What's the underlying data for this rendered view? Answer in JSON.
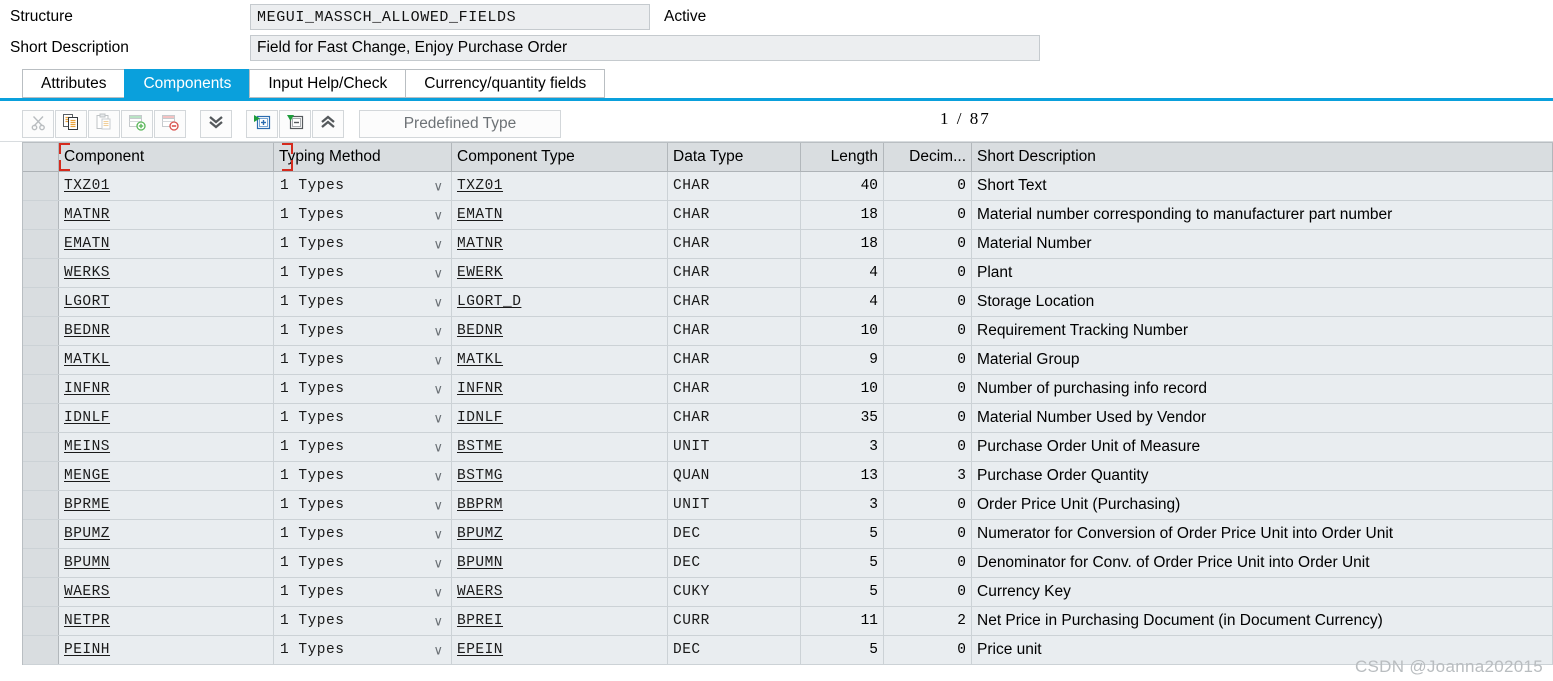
{
  "header": {
    "structure_label": "Structure",
    "structure_name": "MEGUI_MASSCH_ALLOWED_FIELDS",
    "status": "Active",
    "short_desc_label": "Short Description",
    "short_desc_value": "Field for Fast Change, Enjoy Purchase Order"
  },
  "tabs": [
    {
      "label": "Attributes",
      "active": false
    },
    {
      "label": "Components",
      "active": true
    },
    {
      "label": "Input Help/Check",
      "active": false
    },
    {
      "label": "Currency/quantity fields",
      "active": false
    }
  ],
  "toolbar": {
    "buttons": [
      {
        "name": "cut-icon",
        "title": "Cut"
      },
      {
        "name": "copy-icon",
        "title": "Copy"
      },
      {
        "name": "paste-icon",
        "title": "Paste"
      },
      {
        "name": "insert-row-icon",
        "title": "Insert Row"
      },
      {
        "name": "delete-row-icon",
        "title": "Delete Row"
      },
      {
        "name": "chevron-double-down-icon",
        "title": "Expand All"
      },
      {
        "name": "expand-subscreen-icon",
        "title": "Expand"
      },
      {
        "name": "collapse-subscreen-icon",
        "title": "Collapse"
      },
      {
        "name": "chevron-double-up-icon",
        "title": "Collapse All"
      }
    ],
    "predefined_type_label": "Predefined Type",
    "page_current": "1",
    "page_separator": "/",
    "page_total": "87"
  },
  "grid": {
    "columns": [
      "Component",
      "Typing Method",
      "Component Type",
      "Data Type",
      "Length",
      "Decim...",
      "Short Description"
    ],
    "rows": [
      {
        "component": "TXZ01",
        "typing": "1 Types",
        "ctype": "TXZ01",
        "dtype": "CHAR",
        "length": "40",
        "decimals": "0",
        "desc": "Short Text",
        "selected": true
      },
      {
        "component": "MATNR",
        "typing": "1 Types",
        "ctype": "EMATN",
        "dtype": "CHAR",
        "length": "18",
        "decimals": "0",
        "desc": "Material number corresponding to manufacturer part number",
        "selected": false
      },
      {
        "component": "EMATN",
        "typing": "1 Types",
        "ctype": "MATNR",
        "dtype": "CHAR",
        "length": "18",
        "decimals": "0",
        "desc": "Material Number",
        "selected": false
      },
      {
        "component": "WERKS",
        "typing": "1 Types",
        "ctype": "EWERK",
        "dtype": "CHAR",
        "length": "4",
        "decimals": "0",
        "desc": "Plant",
        "selected": false
      },
      {
        "component": "LGORT",
        "typing": "1 Types",
        "ctype": "LGORT_D",
        "dtype": "CHAR",
        "length": "4",
        "decimals": "0",
        "desc": "Storage Location",
        "selected": false
      },
      {
        "component": "BEDNR",
        "typing": "1 Types",
        "ctype": "BEDNR",
        "dtype": "CHAR",
        "length": "10",
        "decimals": "0",
        "desc": "Requirement Tracking Number",
        "selected": false
      },
      {
        "component": "MATKL",
        "typing": "1 Types",
        "ctype": "MATKL",
        "dtype": "CHAR",
        "length": "9",
        "decimals": "0",
        "desc": "Material Group",
        "selected": false
      },
      {
        "component": "INFNR",
        "typing": "1 Types",
        "ctype": "INFNR",
        "dtype": "CHAR",
        "length": "10",
        "decimals": "0",
        "desc": "Number of purchasing info record",
        "selected": false
      },
      {
        "component": "IDNLF",
        "typing": "1 Types",
        "ctype": "IDNLF",
        "dtype": "CHAR",
        "length": "35",
        "decimals": "0",
        "desc": "Material Number Used by Vendor",
        "selected": false
      },
      {
        "component": "MEINS",
        "typing": "1 Types",
        "ctype": "BSTME",
        "dtype": "UNIT",
        "length": "3",
        "decimals": "0",
        "desc": "Purchase Order Unit of Measure",
        "selected": false
      },
      {
        "component": "MENGE",
        "typing": "1 Types",
        "ctype": "BSTMG",
        "dtype": "QUAN",
        "length": "13",
        "decimals": "3",
        "desc": "Purchase Order Quantity",
        "selected": false
      },
      {
        "component": "BPRME",
        "typing": "1 Types",
        "ctype": "BBPRM",
        "dtype": "UNIT",
        "length": "3",
        "decimals": "0",
        "desc": "Order Price Unit (Purchasing)",
        "selected": false
      },
      {
        "component": "BPUMZ",
        "typing": "1 Types",
        "ctype": "BPUMZ",
        "dtype": "DEC",
        "length": "5",
        "decimals": "0",
        "desc": "Numerator for Conversion of Order Price Unit into Order Unit",
        "selected": false
      },
      {
        "component": "BPUMN",
        "typing": "1 Types",
        "ctype": "BPUMN",
        "dtype": "DEC",
        "length": "5",
        "decimals": "0",
        "desc": "Denominator for Conv. of Order Price Unit into Order Unit",
        "selected": false
      },
      {
        "component": "WAERS",
        "typing": "1 Types",
        "ctype": "WAERS",
        "dtype": "CUKY",
        "length": "5",
        "decimals": "0",
        "desc": "Currency Key",
        "selected": false
      },
      {
        "component": "NETPR",
        "typing": "1 Types",
        "ctype": "BPREI",
        "dtype": "CURR",
        "length": "11",
        "decimals": "2",
        "desc": "Net Price in Purchasing Document (in Document Currency)",
        "selected": false
      },
      {
        "component": "PEINH",
        "typing": "1 Types",
        "ctype": "EPEIN",
        "dtype": "DEC",
        "length": "5",
        "decimals": "0",
        "desc": "Price unit",
        "selected": false
      }
    ]
  },
  "watermark": "CSDN @Joanna202015",
  "colors": {
    "accent": "#0aa0dc",
    "selection": "#d52b1e",
    "grid_header": "#d9dde0",
    "row_bg": "#e9edf0",
    "field_bg": "#eceef0"
  }
}
